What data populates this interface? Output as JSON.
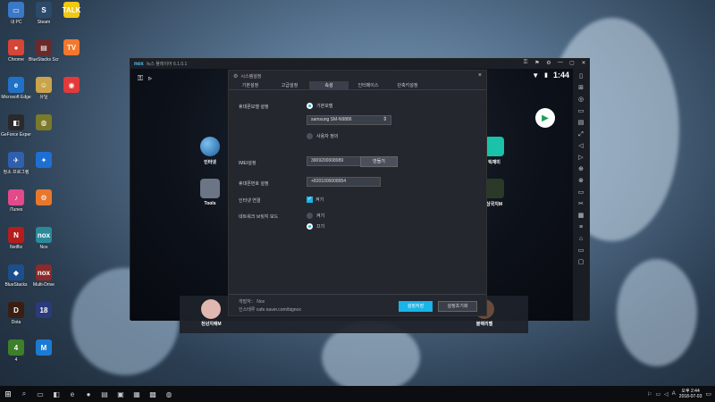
{
  "desktop_icons": [
    {
      "label": "내 PC",
      "color": "#3a78c8",
      "glyph": "▭",
      "col": 0,
      "row": 0
    },
    {
      "label": "Chrome",
      "color": "#d64535",
      "glyph": "●",
      "col": 0,
      "row": 1
    },
    {
      "label": "Microsoft Edge",
      "color": "#1f72c8",
      "glyph": "e",
      "col": 0,
      "row": 2
    },
    {
      "label": "GeForce Experience",
      "color": "#2a2a2a",
      "glyph": "◧",
      "col": 0,
      "row": 3
    },
    {
      "label": "청소 프로그램",
      "color": "#2f5fae",
      "glyph": "✈",
      "col": 0,
      "row": 4
    },
    {
      "label": "iTunes",
      "color": "#e24a8a",
      "glyph": "♪",
      "col": 0,
      "row": 5
    },
    {
      "label": "Netflix",
      "color": "#b51d1d",
      "glyph": "N",
      "col": 0,
      "row": 6
    },
    {
      "label": "BlueStacks",
      "color": "#1c4e8c",
      "glyph": "◆",
      "col": 0,
      "row": 7
    },
    {
      "label": "Dota",
      "color": "#3a1e12",
      "glyph": "D",
      "col": 0,
      "row": 8
    },
    {
      "label": "4",
      "color": "#3d7f2a",
      "glyph": "4",
      "col": 0,
      "row": 9
    },
    {
      "label": "Steam",
      "color": "#2c4a6a",
      "glyph": "S",
      "col": 1,
      "row": 0
    },
    {
      "label": "BlueStacks Screen",
      "color": "#6a2a2a",
      "glyph": "▤",
      "col": 1,
      "row": 1
    },
    {
      "label": "유틸",
      "color": "#c9a44a",
      "glyph": "☺",
      "col": 1,
      "row": 2
    },
    {
      "label": "",
      "color": "#7a7a2a",
      "glyph": "◍",
      "col": 1,
      "row": 3
    },
    {
      "label": "",
      "color": "#1d6fd4",
      "glyph": "✦",
      "col": 1,
      "row": 4
    },
    {
      "label": "",
      "color": "#e8772c",
      "glyph": "⚙",
      "col": 1,
      "row": 5
    },
    {
      "label": "Nox",
      "color": "#2a8a9a",
      "glyph": "nox",
      "col": 1,
      "row": 6
    },
    {
      "label": "Multi-Drive",
      "color": "#8a2a2a",
      "glyph": "nox",
      "col": 1,
      "row": 7
    },
    {
      "label": "",
      "color": "#2a3a7a",
      "glyph": "18",
      "col": 1,
      "row": 8
    },
    {
      "label": "",
      "color": "#1c7ad2",
      "glyph": "M",
      "col": 1,
      "row": 9
    },
    {
      "label": "",
      "color": "#f2c811",
      "glyph": "TALK",
      "col": 2,
      "row": 0
    },
    {
      "label": "",
      "color": "#f3772c",
      "glyph": "TV",
      "col": 2,
      "row": 1
    },
    {
      "label": "",
      "color": "#e23a3a",
      "glyph": "◉",
      "col": 2,
      "row": 2
    }
  ],
  "nox": {
    "logo": "nox",
    "title": "녹스 플레이어 6.1.0.1",
    "title_ctrls": [
      "⚿",
      "⚑",
      "⚙",
      "—",
      "▢",
      "✕"
    ],
    "status_time": "1:44",
    "toolbar_icons": [
      "▯",
      "⊞",
      "◎",
      "▭",
      "▤",
      "⤢",
      "◁",
      "▷",
      "⊕",
      "⊗",
      "▭",
      "✂",
      "▦",
      "≡",
      "⌂",
      "▭",
      "▢"
    ],
    "home_apps": [
      {
        "label": "인터넷",
        "color": "#3b7dc2"
      },
      {
        "label": "Tools",
        "color": "#7a8595"
      },
      {
        "label": "틱재미",
        "color": "#19c2a8"
      },
      {
        "label": "삼국지M",
        "color": "#2b3a28"
      }
    ],
    "dock_labels": [
      "천년지애M",
      "",
      "",
      "",
      "블랙리벨"
    ]
  },
  "settings": {
    "title": "시스템설정",
    "close": "×",
    "tabs": [
      "기본설정",
      "고급설정",
      "속성",
      "인터페이스",
      "단축키설정"
    ],
    "active_tab": 2,
    "phone_model_label": "휴대폰모델 설정",
    "radio_preset": "기본모델",
    "model_value": "samsung SM-N9886",
    "radio_custom": "사용자 정의",
    "imei_label": "IMEI설정",
    "imei_value": "3909200008989",
    "create_button": "만들기",
    "phone_number_label": "휴대폰번호 설정",
    "phone_number_value": "+8201000008954",
    "internet_label": "인터넷 연결",
    "internet_on": "켜기",
    "bridge_label": "네트워크 브릿지 모드",
    "bridge_on": "켜기",
    "bridge_off": "끄기",
    "developer_label": "개발자：",
    "developer_value": "Nox",
    "cafe_label": "인스테루",
    "cafe_value": "cafe.naver.com/bignox",
    "save_button": "설정저장",
    "reset_button": "설정초기화"
  },
  "taskbar": {
    "start_glyph": "⊞",
    "items": [
      "⌕",
      "▭",
      "◧",
      "e",
      "●",
      "▤",
      "▣",
      "▦",
      "▩",
      "◍"
    ],
    "tray_icons": [
      "⚐",
      "▭",
      "◁",
      "A"
    ],
    "clock_time": "오후 2:44",
    "clock_date": "2018-07-03"
  }
}
